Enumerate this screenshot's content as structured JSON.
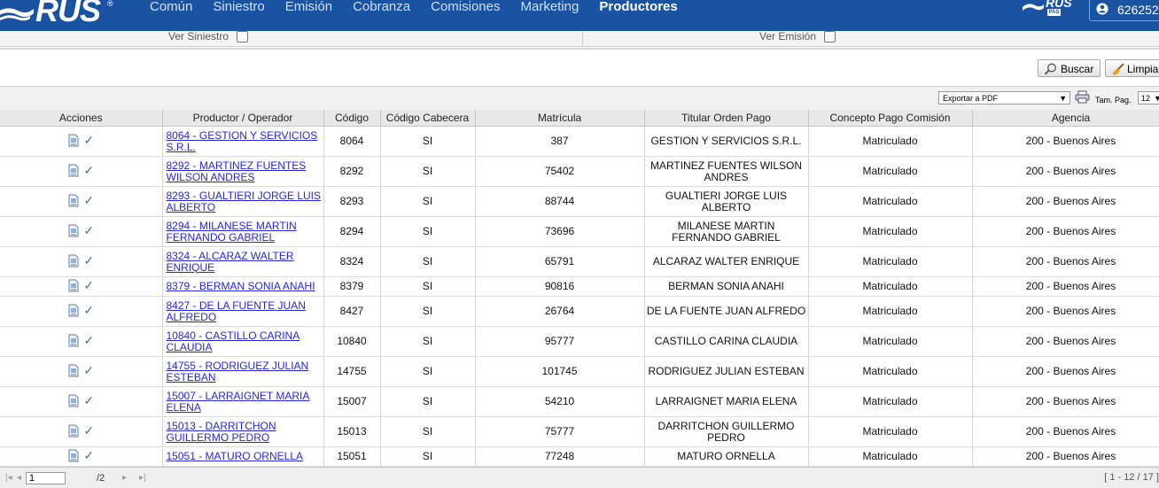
{
  "header": {
    "logo_text": "RUS",
    "nav": [
      "Común",
      "Siniestro",
      "Emisión",
      "Cobranza",
      "Comisiones",
      "Marketing",
      "Productores"
    ],
    "active_nav": "Productores",
    "mini_logo_text": "RUS",
    "mini_logo_sub": "PAS",
    "user_id": "626252"
  },
  "filters": {
    "ver_siniestro": "Ver Siniestro",
    "ver_emision": "Ver Emisión"
  },
  "actions": {
    "buscar": "Buscar",
    "limpiar": "Limpiar"
  },
  "toolbar": {
    "export_value": "Exportar a PDF",
    "tam_label": "Tam. Pag.",
    "tam_value": "12"
  },
  "columns": [
    "Acciones",
    "Productor / Operador",
    "Código",
    "Código Cabecera",
    "Matrícula",
    "Titular Orden Pago",
    "Concepto Pago Comisión",
    "Agencia"
  ],
  "rows": [
    {
      "productor": "8064 - GESTION Y SERVICIOS S.R.L.",
      "codigo": "8064",
      "cabecera": "SI",
      "matricula": "387",
      "titular": "GESTION Y SERVICIOS S.R.L.",
      "concepto": "Matriculado",
      "agencia": "200 - Buenos Aires"
    },
    {
      "productor": "8292 - MARTINEZ FUENTES WILSON ANDRES",
      "codigo": "8292",
      "cabecera": "SI",
      "matricula": "75402",
      "titular": "MARTINEZ FUENTES WILSON ANDRES",
      "concepto": "Matriculado",
      "agencia": "200 - Buenos Aires"
    },
    {
      "productor": "8293 - GUALTIERI JORGE LUIS ALBERTO",
      "codigo": "8293",
      "cabecera": "SI",
      "matricula": "88744",
      "titular": "GUALTIERI JORGE LUIS ALBERTO",
      "concepto": "Matriculado",
      "agencia": "200 - Buenos Aires"
    },
    {
      "productor": "8294 - MILANESE MARTIN FERNANDO GABRIEL",
      "codigo": "8294",
      "cabecera": "SI",
      "matricula": "73696",
      "titular": "MILANESE MARTIN FERNANDO GABRIEL",
      "concepto": "Matriculado",
      "agencia": "200 - Buenos Aires"
    },
    {
      "productor": "8324 - ALCARAZ WALTER ENRIQUE",
      "codigo": "8324",
      "cabecera": "SI",
      "matricula": "65791",
      "titular": "ALCARAZ WALTER ENRIQUE",
      "concepto": "Matriculado",
      "agencia": "200 - Buenos Aires"
    },
    {
      "productor": "8379 - BERMAN SONIA ANAHI",
      "codigo": "8379",
      "cabecera": "SI",
      "matricula": "90816",
      "titular": "BERMAN SONIA ANAHI",
      "concepto": "Matriculado",
      "agencia": "200 - Buenos Aires"
    },
    {
      "productor": "8427 - DE LA FUENTE JUAN ALFREDO",
      "codigo": "8427",
      "cabecera": "SI",
      "matricula": "26764",
      "titular": "DE LA FUENTE JUAN ALFREDO",
      "concepto": "Matriculado",
      "agencia": "200 - Buenos Aires"
    },
    {
      "productor": "10840 - CASTILLO CARINA CLAUDIA",
      "codigo": "10840",
      "cabecera": "SI",
      "matricula": "95777",
      "titular": "CASTILLO CARINA CLAUDIA",
      "concepto": "Matriculado",
      "agencia": "200 - Buenos Aires"
    },
    {
      "productor": "14755 - RODRIGUEZ JULIAN ESTEBAN",
      "codigo": "14755",
      "cabecera": "SI",
      "matricula": "101745",
      "titular": "RODRIGUEZ JULIAN ESTEBAN",
      "concepto": "Matriculado",
      "agencia": "200 - Buenos Aires"
    },
    {
      "productor": "15007 - LARRAIGNET MARIA ELENA",
      "codigo": "15007",
      "cabecera": "SI",
      "matricula": "54210",
      "titular": "LARRAIGNET MARIA ELENA",
      "concepto": "Matriculado",
      "agencia": "200 - Buenos Aires"
    },
    {
      "productor": "15013 - DARRITCHON GUILLERMO PEDRO",
      "codigo": "15013",
      "cabecera": "SI",
      "matricula": "75777",
      "titular": "DARRITCHON GUILLERMO PEDRO",
      "concepto": "Matriculado",
      "agencia": "200 - Buenos Aires"
    },
    {
      "productor": "15051 - MATURO ORNELLA",
      "codigo": "15051",
      "cabecera": "SI",
      "matricula": "77248",
      "titular": "MATURO ORNELLA",
      "concepto": "Matriculado",
      "agencia": "200 - Buenos Aires"
    }
  ],
  "pager": {
    "current_page": "1",
    "total_pages": "/2",
    "range": "[ 1 - 12 / 17 ]"
  },
  "colors": {
    "header_bg": "#1b53a3",
    "link": "#2727d8",
    "check": "#3a72c4"
  }
}
